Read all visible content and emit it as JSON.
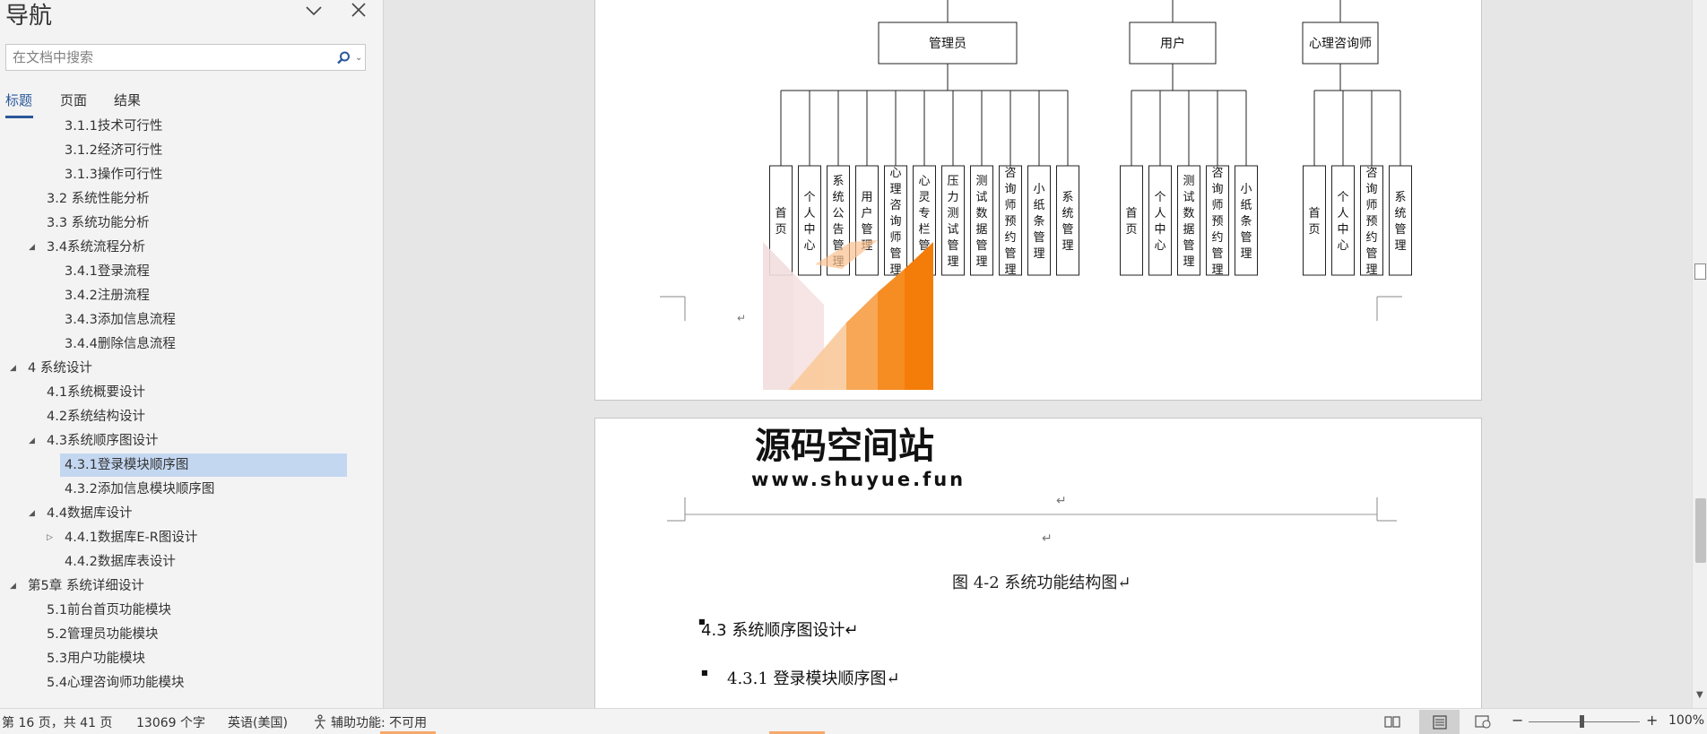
{
  "nav": {
    "title": "导航",
    "search_placeholder": "在文档中搜索",
    "tabs": [
      "标题",
      "页面",
      "结果"
    ],
    "outline": [
      {
        "text": "3.1.1技术可行性",
        "level": 3
      },
      {
        "text": "3.1.2经济可行性",
        "level": 3
      },
      {
        "text": "3.1.3操作可行性",
        "level": 3
      },
      {
        "text": "3.2 系统性能分析",
        "level": 2
      },
      {
        "text": "3.3 系统功能分析",
        "level": 2
      },
      {
        "text": "3.4系统流程分析",
        "level": 2,
        "toggle": "expanded"
      },
      {
        "text": "3.4.1登录流程",
        "level": 3
      },
      {
        "text": "3.4.2注册流程",
        "level": 3
      },
      {
        "text": "3.4.3添加信息流程",
        "level": 3
      },
      {
        "text": "3.4.4删除信息流程",
        "level": 3
      },
      {
        "text": "4 系统设计",
        "level": 1,
        "toggle": "expanded"
      },
      {
        "text": "4.1系统概要设计",
        "level": 2
      },
      {
        "text": "4.2系统结构设计",
        "level": 2
      },
      {
        "text": "4.3系统顺序图设计",
        "level": 2,
        "toggle": "expanded"
      },
      {
        "text": "4.3.1登录模块顺序图",
        "level": 3,
        "selected": true
      },
      {
        "text": "4.3.2添加信息模块顺序图",
        "level": 3
      },
      {
        "text": "4.4数据库设计",
        "level": 2,
        "toggle": "expanded"
      },
      {
        "text": "4.4.1数据库E-R图设计",
        "level": 3,
        "toggle": "collapsed"
      },
      {
        "text": "4.4.2数据库表设计",
        "level": 3
      },
      {
        "text": "第5章 系统详细设计",
        "level": 1,
        "toggle": "expanded"
      },
      {
        "text": "5.1前台首页功能模块",
        "level": 2
      },
      {
        "text": "5.2管理员功能模块",
        "level": 2
      },
      {
        "text": "5.3用户功能模块",
        "level": 2
      },
      {
        "text": "5.4心理咨询师功能模块",
        "level": 2
      }
    ]
  },
  "diagram": {
    "roles": [
      {
        "name": "管理员",
        "children": [
          "首页",
          "个人中心",
          "系统公告管理",
          "用户管理",
          "心理咨询师管理",
          "心灵专栏管理",
          "压力测试管理",
          "测试数据管理",
          "咨询师预约管理",
          "小纸条管理",
          "系统管理"
        ]
      },
      {
        "name": "用户",
        "children": [
          "首页",
          "个人中心",
          "测试数据管理",
          "咨询师预约管理",
          "小纸条管理"
        ]
      },
      {
        "name": "心理咨询师",
        "children": [
          "首页",
          "个人中心",
          "咨询师预约管理",
          "系统管理"
        ]
      }
    ]
  },
  "watermark": {
    "title": "源码空间站",
    "url": "www.shuyue.fun"
  },
  "page2": {
    "return_mark": "↵",
    "caption": "图 4-2  系统功能结构图↵",
    "heading": "4.3 系统顺序图设计↵",
    "subheading": "4.3.1 登录模块顺序图↵"
  },
  "status": {
    "page": "第 16 页，共 41 页",
    "words": "13069 个字",
    "language": "英语(美国)",
    "accessibility": "辅助功能: 不可用",
    "zoom_minus": "−",
    "zoom_plus": "+",
    "zoom": "100%",
    "zoom_level_percent": 100
  }
}
